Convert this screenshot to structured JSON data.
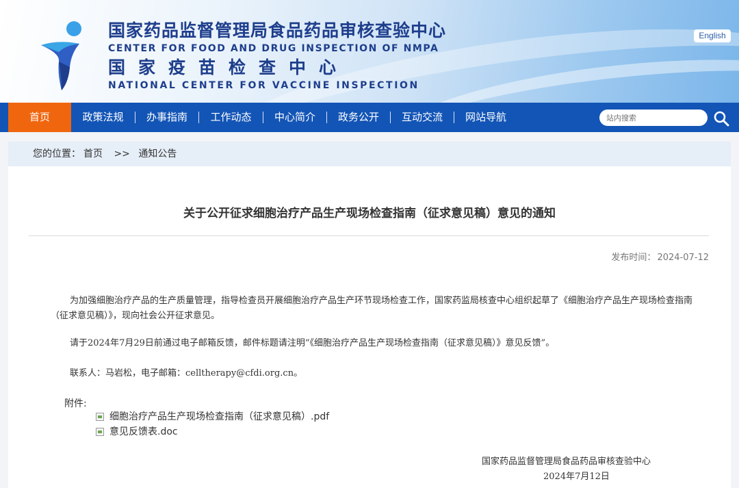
{
  "header": {
    "cn_title": "国家药品监督管理局食品药品审核查验中心",
    "en_title": "CENTER FOR FOOD AND DRUG INSPECTION OF NMPA",
    "cn_subtitle": "国家疫苗检查中心",
    "en_subtitle": "NATIONAL CENTER FOR VACCINE INSPECTION",
    "lang_button": "English"
  },
  "nav": {
    "items": [
      {
        "label": "首页",
        "active": true
      },
      {
        "label": "政策法规"
      },
      {
        "label": "办事指南"
      },
      {
        "label": "工作动态"
      },
      {
        "label": "中心简介"
      },
      {
        "label": "政务公开"
      },
      {
        "label": "互动交流"
      },
      {
        "label": "网站导航"
      }
    ],
    "search_placeholder": "站内搜索"
  },
  "breadcrumb": {
    "prefix": "您的位置：",
    "home": "首页",
    "sep": ">>",
    "current": "通知公告"
  },
  "article": {
    "title": "关于公开征求细胞治疗产品生产现场检查指南（征求意见稿）意见的通知",
    "date_label": "发布时间：",
    "date": "2024-07-12",
    "paragraphs": [
      "为加强细胞治疗产品的生产质量管理，指导检查员开展细胞治疗产品生产环节现场检查工作，国家药监局核查中心组织起草了《细胞治疗产品生产现场检查指南（征求意见稿）》，现向社会公开征求意见。",
      "请于2024年7月29日前通过电子邮箱反馈，邮件标题请注明“《细胞治疗产品生产现场检查指南（征求意见稿）》意见反馈”。",
      "联系人：马岩松，电子邮箱：celltherapy@cfdi.org.cn。"
    ],
    "attachments_label": "附件:",
    "attachments": [
      "细胞治疗产品生产现场检查指南（征求意见稿）.pdf",
      "意见反馈表.doc"
    ],
    "signature_org": "国家药品监督管理局食品药品审核查验中心",
    "signature_date": "2024年7月12日"
  },
  "colors": {
    "nav_bg": "#1355b6",
    "nav_active": "#f0660e",
    "title_blue": "#1e3e8c"
  }
}
